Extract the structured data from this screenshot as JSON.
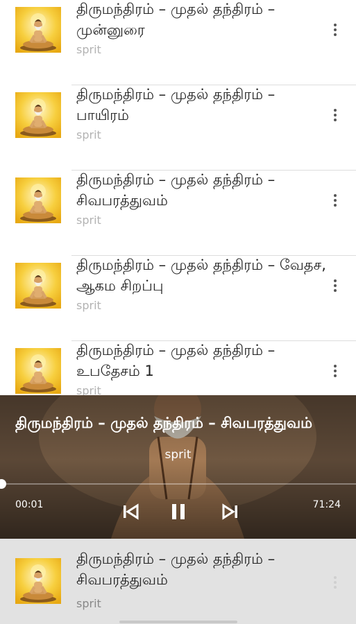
{
  "playlist": {
    "items": [
      {
        "title": "திருமந்திரம் – முதல் தந்திரம் – முன்னுரை",
        "artist": "sprit"
      },
      {
        "title": "திருமந்திரம் – முதல் தந்திரம் – பாயிரம்",
        "artist": "sprit"
      },
      {
        "title": "திருமந்திரம் – முதல் தந்திரம் – சிவபரத்துவம்",
        "artist": "sprit"
      },
      {
        "title": "திருமந்திரம் – முதல் தந்திரம் – வேதச, ஆகம சிறப்பு",
        "artist": "sprit"
      },
      {
        "title": "திருமந்திரம் – முதல் தந்திரம் – உபதேசம் 1",
        "artist": "sprit"
      }
    ]
  },
  "player": {
    "title": "திருமந்திரம் – முதல் தந்திரம் – சிவபரத்துவம்",
    "artist": "sprit",
    "current_time": "00:01",
    "total_time": "71:24",
    "progress_fraction": 0.0002
  },
  "now_playing": {
    "title": "திருமந்திரம் – முதல் தந்திரம் – சிவபரத்துவம்",
    "artist": "sprit"
  },
  "icons": {
    "more": "more-vert-icon",
    "previous": "skip-previous-icon",
    "pause": "pause-icon",
    "next": "skip-next-icon"
  },
  "colors": {
    "thumb_background": "#f5c531",
    "text_primary": "#222222",
    "text_secondary": "#b3b3b3",
    "mini_player_background": "#e2e2e2"
  }
}
